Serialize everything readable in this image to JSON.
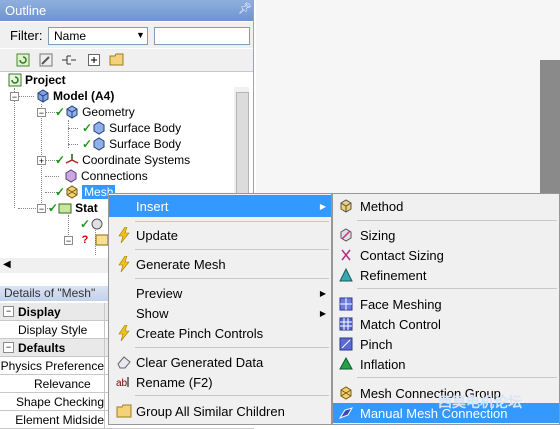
{
  "outline": {
    "title": "Outline",
    "filter_label": "Filter:",
    "filter_value": "Name"
  },
  "tree": [
    {
      "label": "Project"
    },
    {
      "label": "Model (A4)"
    },
    {
      "label": "Geometry"
    },
    {
      "label": "Surface Body"
    },
    {
      "label": "Surface Body"
    },
    {
      "label": "Coordinate Systems"
    },
    {
      "label": "Connections"
    },
    {
      "label": "Mesh"
    },
    {
      "label": "Stat"
    }
  ],
  "details": {
    "title": "Details of \"Mesh\"",
    "rows": [
      {
        "label": "Display",
        "group": true
      },
      {
        "label": "Display Style",
        "group": false
      },
      {
        "label": "Defaults",
        "group": true
      },
      {
        "label": "Physics Preference",
        "group": false
      },
      {
        "label": "Relevance",
        "group": false
      },
      {
        "label": "Shape Checking",
        "group": false
      },
      {
        "label": "Element Midside",
        "group": false
      }
    ]
  },
  "context_menu": {
    "items": [
      {
        "label": "Insert",
        "icon": "none",
        "submenu": true
      },
      {
        "label": "Update",
        "icon": "lightning-icon"
      },
      {
        "label": "Generate Mesh",
        "icon": "lightning-icon"
      },
      {
        "label": "Preview",
        "icon": "none",
        "submenu": true
      },
      {
        "label": "Show",
        "icon": "none",
        "submenu": true
      },
      {
        "label": "Create Pinch Controls",
        "icon": "lightning-icon"
      },
      {
        "label": "Clear Generated Data",
        "icon": "eraser-icon"
      },
      {
        "label": "Rename (F2)",
        "icon": "rename-icon"
      },
      {
        "label": "Group All Similar Children",
        "icon": "folder-icon"
      }
    ]
  },
  "sub_menu": {
    "items": [
      {
        "label": "Method",
        "icon": "method-icon"
      },
      {
        "label": "Sizing",
        "icon": "sizing-icon"
      },
      {
        "label": "Contact Sizing",
        "icon": "contact-sizing-icon"
      },
      {
        "label": "Refinement",
        "icon": "refinement-icon"
      },
      {
        "label": "Face Meshing",
        "icon": "face-meshing-icon"
      },
      {
        "label": "Match Control",
        "icon": "match-control-icon"
      },
      {
        "label": "Pinch",
        "icon": "pinch-icon"
      },
      {
        "label": "Inflation",
        "icon": "inflation-icon"
      },
      {
        "label": "Mesh Connection Group",
        "icon": "mesh-connection-group-icon"
      },
      {
        "label": "Manual Mesh Connection",
        "icon": "manual-mesh-connection-icon"
      }
    ]
  },
  "watermark": "西莫电机论坛",
  "colors": {
    "selection": "#3399ff",
    "title_bar": "#7a9fd6",
    "check_green": "#1e9c1e"
  }
}
